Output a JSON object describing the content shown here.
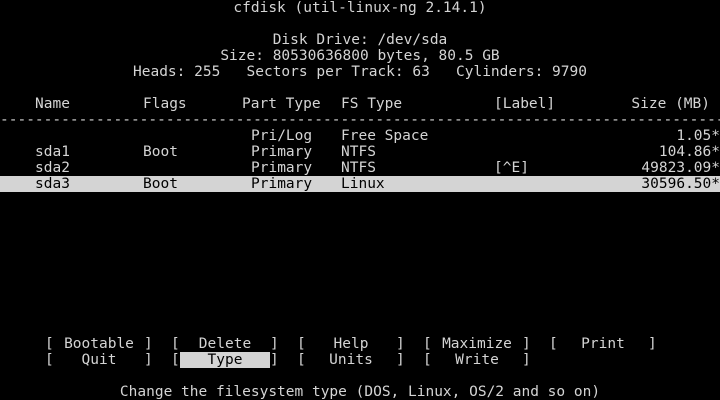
{
  "header": {
    "title": "cfdisk (util-linux-ng 2.14.1)",
    "disk_drive": "Disk Drive: /dev/sda",
    "size": "Size: 80530636800 bytes, 80.5 GB",
    "geometry": "Heads: 255   Sectors per Track: 63   Cylinders: 9790"
  },
  "table": {
    "columns": {
      "name": "Name",
      "flags": "Flags",
      "part_type": "Part Type",
      "fs_type": "FS Type",
      "label": "[Label]",
      "size": "Size (MB)"
    },
    "rule": "-----------------------------------------------------------------------------------------------------",
    "rows": [
      {
        "name": "",
        "flags": "",
        "part_type": "Pri/Log",
        "fs_type": "Free Space",
        "label": "",
        "size": "1.05*"
      },
      {
        "name": "sda1",
        "flags": "Boot",
        "part_type": "Primary",
        "fs_type": "NTFS",
        "label": "",
        "size": "104.86*"
      },
      {
        "name": "sda2",
        "flags": "",
        "part_type": "Primary",
        "fs_type": "NTFS",
        "label": "[^E]",
        "size": "49823.09*"
      },
      {
        "name": "sda3",
        "flags": "Boot",
        "part_type": "Primary",
        "fs_type": "Linux",
        "label": "",
        "size": "30596.50*"
      }
    ],
    "selected_row": "sda3"
  },
  "menu": {
    "row1": [
      "Bootable",
      "Delete",
      "Help",
      "Maximize",
      "Print"
    ],
    "row2": [
      "Quit",
      "Type",
      "Units",
      "Write"
    ],
    "active": "Type",
    "bracket_open": "[",
    "bracket_close": "]"
  },
  "status": {
    "help_text": "Change the filesystem type (DOS, Linux, OS/2 and so on)"
  },
  "colors": {
    "background": "#000000",
    "foreground": "#d4d4d4",
    "highlight_bg": "#d4d4d4",
    "highlight_fg": "#000000"
  }
}
